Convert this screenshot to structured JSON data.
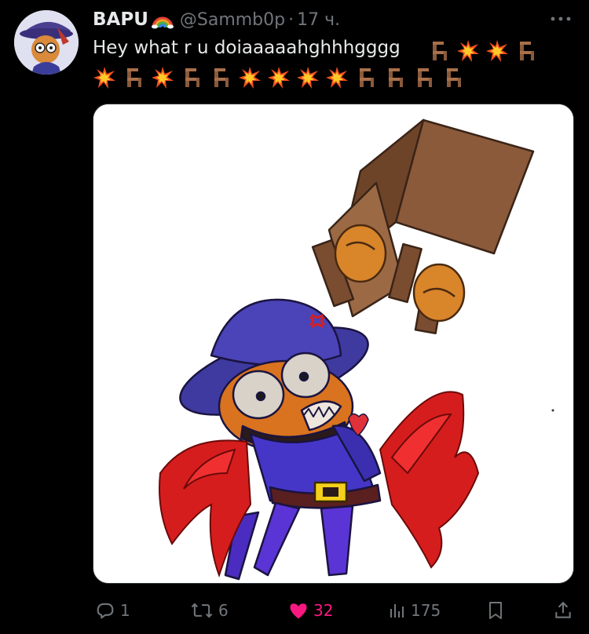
{
  "tweet": {
    "display_name": "BAPU",
    "name_emoji": "rainbow-emoji",
    "handle": "@Sammb0p",
    "separator": "·",
    "time": "17 ч.",
    "text": "Hey what r u doiaaaaahghhhgggg",
    "emoji_sequence_line1": [
      "chair",
      "collision",
      "collision",
      "chair"
    ],
    "emoji_sequence_line2": [
      "collision",
      "chair",
      "collision",
      "chair",
      "chair",
      "collision",
      "collision",
      "collision",
      "collision",
      "chair",
      "chair",
      "chair",
      "chair"
    ],
    "media_description_icon": "drawing-image"
  },
  "actions": {
    "reply_count": "1",
    "repost_count": "6",
    "like_count": "32",
    "views_count": "175"
  },
  "colors": {
    "background": "#000000",
    "text": "#e7e9ea",
    "secondary": "#71767b",
    "like": "#f91880"
  }
}
